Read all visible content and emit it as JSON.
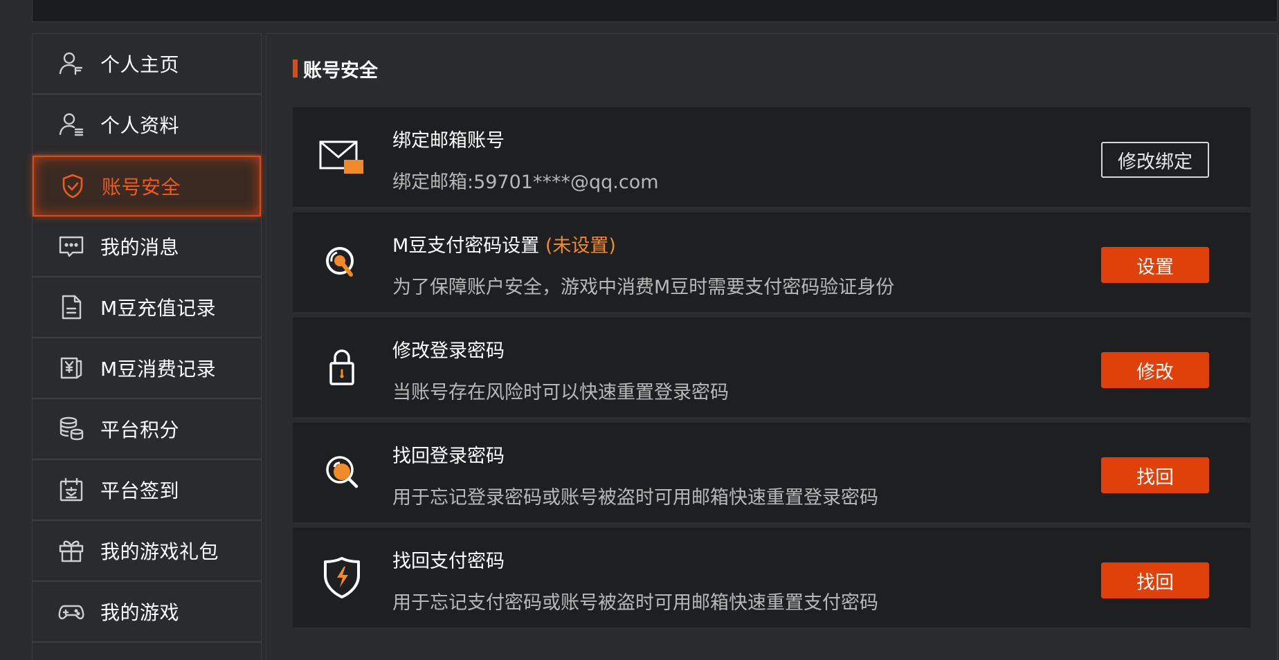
{
  "sidebar": {
    "items": [
      {
        "label": "个人主页",
        "icon": "user-home-icon"
      },
      {
        "label": "个人资料",
        "icon": "user-profile-icon"
      },
      {
        "label": "账号安全",
        "icon": "shield-check-icon",
        "active": true
      },
      {
        "label": "我的消息",
        "icon": "message-icon"
      },
      {
        "label": "M豆充值记录",
        "icon": "document-icon"
      },
      {
        "label": "M豆消费记录",
        "icon": "receipt-icon"
      },
      {
        "label": "平台积分",
        "icon": "coins-icon"
      },
      {
        "label": "平台签到",
        "icon": "calendar-sign-icon"
      },
      {
        "label": "我的游戏礼包",
        "icon": "gift-icon"
      },
      {
        "label": "我的游戏",
        "icon": "gamepad-icon"
      }
    ]
  },
  "main": {
    "title": "账号安全",
    "cards": [
      {
        "title": "绑定邮箱账号",
        "tag": "",
        "desc": "绑定邮箱:59701****@qq.com",
        "button": "修改绑定",
        "icon": "mail-icon"
      },
      {
        "title": "M豆支付密码设置 ",
        "tag": "(未设置)",
        "desc": "为了保障账户安全，游戏中消费M豆时需要支付密码验证身份",
        "button": "设置",
        "icon": "pay-password-icon"
      },
      {
        "title": "修改登录密码",
        "tag": "",
        "desc": "当账号存在风险时可以快速重置登录密码",
        "button": "修改",
        "icon": "lock-icon"
      },
      {
        "title": "找回登录密码",
        "tag": "",
        "desc": "用于忘记登录密码或账号被盗时可用邮箱快速重置登录密码",
        "button": "找回",
        "icon": "search-key-icon"
      },
      {
        "title": "找回支付密码",
        "tag": "",
        "desc": "用于忘记支付密码或账号被盗时可用邮箱快速重置支付密码",
        "button": "找回",
        "icon": "shield-bolt-icon"
      }
    ]
  },
  "colors": {
    "accent": "#e0400a",
    "tag": "#f08a2a"
  }
}
